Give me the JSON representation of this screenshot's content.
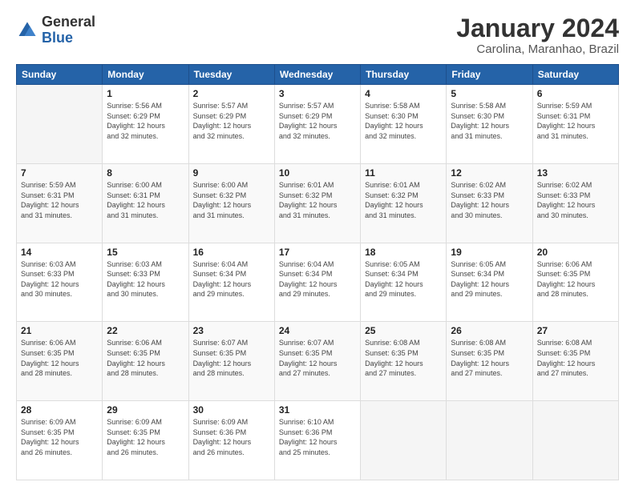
{
  "logo": {
    "general": "General",
    "blue": "Blue"
  },
  "header": {
    "month": "January 2024",
    "location": "Carolina, Maranhao, Brazil"
  },
  "weekdays": [
    "Sunday",
    "Monday",
    "Tuesday",
    "Wednesday",
    "Thursday",
    "Friday",
    "Saturday"
  ],
  "weeks": [
    [
      {
        "day": "",
        "info": ""
      },
      {
        "day": "1",
        "info": "Sunrise: 5:56 AM\nSunset: 6:29 PM\nDaylight: 12 hours\nand 32 minutes."
      },
      {
        "day": "2",
        "info": "Sunrise: 5:57 AM\nSunset: 6:29 PM\nDaylight: 12 hours\nand 32 minutes."
      },
      {
        "day": "3",
        "info": "Sunrise: 5:57 AM\nSunset: 6:29 PM\nDaylight: 12 hours\nand 32 minutes."
      },
      {
        "day": "4",
        "info": "Sunrise: 5:58 AM\nSunset: 6:30 PM\nDaylight: 12 hours\nand 32 minutes."
      },
      {
        "day": "5",
        "info": "Sunrise: 5:58 AM\nSunset: 6:30 PM\nDaylight: 12 hours\nand 31 minutes."
      },
      {
        "day": "6",
        "info": "Sunrise: 5:59 AM\nSunset: 6:31 PM\nDaylight: 12 hours\nand 31 minutes."
      }
    ],
    [
      {
        "day": "7",
        "info": "Sunrise: 5:59 AM\nSunset: 6:31 PM\nDaylight: 12 hours\nand 31 minutes."
      },
      {
        "day": "8",
        "info": "Sunrise: 6:00 AM\nSunset: 6:31 PM\nDaylight: 12 hours\nand 31 minutes."
      },
      {
        "day": "9",
        "info": "Sunrise: 6:00 AM\nSunset: 6:32 PM\nDaylight: 12 hours\nand 31 minutes."
      },
      {
        "day": "10",
        "info": "Sunrise: 6:01 AM\nSunset: 6:32 PM\nDaylight: 12 hours\nand 31 minutes."
      },
      {
        "day": "11",
        "info": "Sunrise: 6:01 AM\nSunset: 6:32 PM\nDaylight: 12 hours\nand 31 minutes."
      },
      {
        "day": "12",
        "info": "Sunrise: 6:02 AM\nSunset: 6:33 PM\nDaylight: 12 hours\nand 30 minutes."
      },
      {
        "day": "13",
        "info": "Sunrise: 6:02 AM\nSunset: 6:33 PM\nDaylight: 12 hours\nand 30 minutes."
      }
    ],
    [
      {
        "day": "14",
        "info": "Sunrise: 6:03 AM\nSunset: 6:33 PM\nDaylight: 12 hours\nand 30 minutes."
      },
      {
        "day": "15",
        "info": "Sunrise: 6:03 AM\nSunset: 6:33 PM\nDaylight: 12 hours\nand 30 minutes."
      },
      {
        "day": "16",
        "info": "Sunrise: 6:04 AM\nSunset: 6:34 PM\nDaylight: 12 hours\nand 29 minutes."
      },
      {
        "day": "17",
        "info": "Sunrise: 6:04 AM\nSunset: 6:34 PM\nDaylight: 12 hours\nand 29 minutes."
      },
      {
        "day": "18",
        "info": "Sunrise: 6:05 AM\nSunset: 6:34 PM\nDaylight: 12 hours\nand 29 minutes."
      },
      {
        "day": "19",
        "info": "Sunrise: 6:05 AM\nSunset: 6:34 PM\nDaylight: 12 hours\nand 29 minutes."
      },
      {
        "day": "20",
        "info": "Sunrise: 6:06 AM\nSunset: 6:35 PM\nDaylight: 12 hours\nand 28 minutes."
      }
    ],
    [
      {
        "day": "21",
        "info": "Sunrise: 6:06 AM\nSunset: 6:35 PM\nDaylight: 12 hours\nand 28 minutes."
      },
      {
        "day": "22",
        "info": "Sunrise: 6:06 AM\nSunset: 6:35 PM\nDaylight: 12 hours\nand 28 minutes."
      },
      {
        "day": "23",
        "info": "Sunrise: 6:07 AM\nSunset: 6:35 PM\nDaylight: 12 hours\nand 28 minutes."
      },
      {
        "day": "24",
        "info": "Sunrise: 6:07 AM\nSunset: 6:35 PM\nDaylight: 12 hours\nand 27 minutes."
      },
      {
        "day": "25",
        "info": "Sunrise: 6:08 AM\nSunset: 6:35 PM\nDaylight: 12 hours\nand 27 minutes."
      },
      {
        "day": "26",
        "info": "Sunrise: 6:08 AM\nSunset: 6:35 PM\nDaylight: 12 hours\nand 27 minutes."
      },
      {
        "day": "27",
        "info": "Sunrise: 6:08 AM\nSunset: 6:35 PM\nDaylight: 12 hours\nand 27 minutes."
      }
    ],
    [
      {
        "day": "28",
        "info": "Sunrise: 6:09 AM\nSunset: 6:35 PM\nDaylight: 12 hours\nand 26 minutes."
      },
      {
        "day": "29",
        "info": "Sunrise: 6:09 AM\nSunset: 6:35 PM\nDaylight: 12 hours\nand 26 minutes."
      },
      {
        "day": "30",
        "info": "Sunrise: 6:09 AM\nSunset: 6:36 PM\nDaylight: 12 hours\nand 26 minutes."
      },
      {
        "day": "31",
        "info": "Sunrise: 6:10 AM\nSunset: 6:36 PM\nDaylight: 12 hours\nand 25 minutes."
      },
      {
        "day": "",
        "info": ""
      },
      {
        "day": "",
        "info": ""
      },
      {
        "day": "",
        "info": ""
      }
    ]
  ]
}
